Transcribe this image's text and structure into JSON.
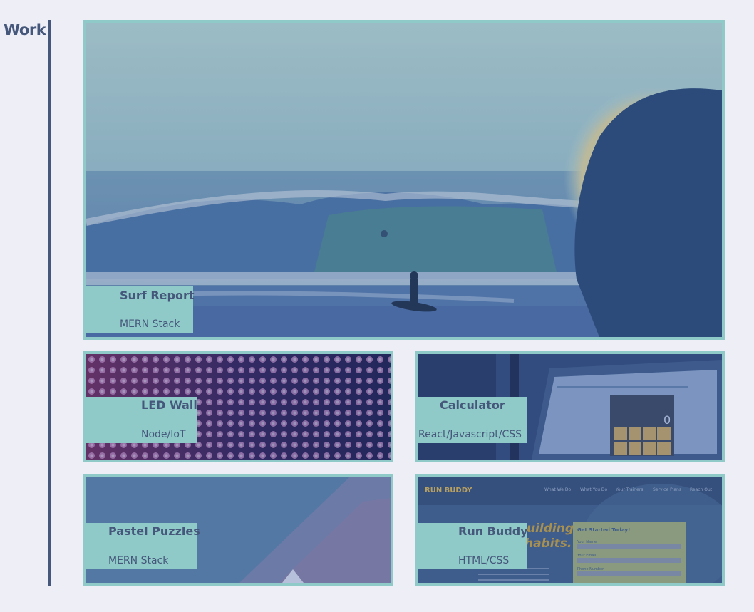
{
  "section": {
    "title": "Work"
  },
  "projects": [
    {
      "name": "Surf Report",
      "stack": "MERN Stack"
    },
    {
      "name": "LED Wall",
      "stack": "Node/IoT"
    },
    {
      "name": "Calculator",
      "stack": "React/Javascript/CSS"
    },
    {
      "name": "Pastel Puzzles",
      "stack": "MERN Stack"
    },
    {
      "name": "Run Buddy",
      "stack": "HTML/CSS"
    }
  ],
  "run_buddy_screenshot": {
    "logo": "RUN BUDDY",
    "nav": [
      "What We Do",
      "What You Do",
      "Your Trainers",
      "Service Plans",
      "Reach Out"
    ],
    "hero": [
      "Building",
      "habits."
    ],
    "form_title": "Get Started Today!",
    "form_fields": [
      "Your Name",
      "Your Email",
      "Phone Number"
    ]
  },
  "calculator_display": "0",
  "colors": {
    "accent": "#8fcac9",
    "text": "#45577a",
    "background": "#eeeef6"
  }
}
